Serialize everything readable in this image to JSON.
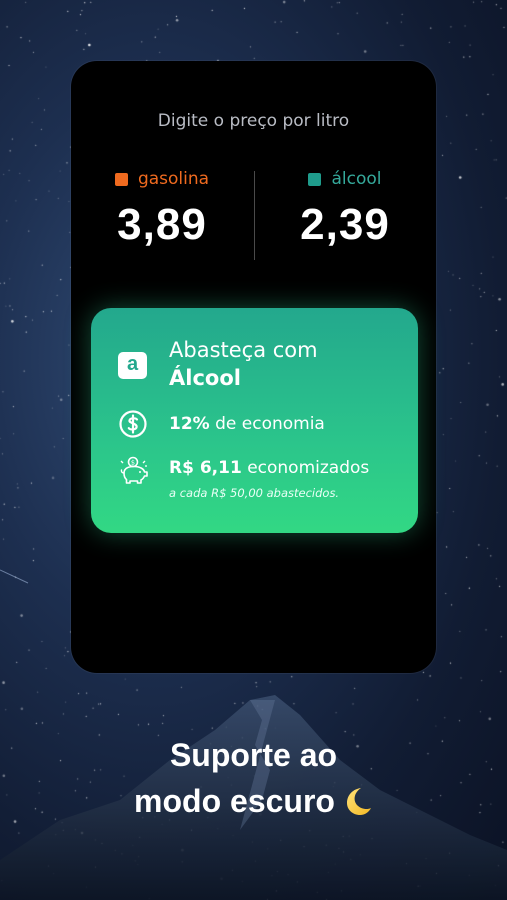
{
  "prompt": "Digite o preço por litro",
  "fuels": {
    "gasoline": {
      "label": "gasolina",
      "price": "3,89",
      "color": "#ef6a1f",
      "icon": "square-swatch-icon"
    },
    "alcohol": {
      "label": "álcool",
      "price": "2,39",
      "color": "#1f9c8c",
      "icon": "square-swatch-icon"
    }
  },
  "recommendation": {
    "badge": "a",
    "line1": "Abasteça com",
    "fuel": "Álcool",
    "economy_percent": "12%",
    "economy_text": "de economia",
    "savings_value": "R$ 6,11",
    "savings_text": "economizados",
    "savings_note": "a cada R$ 50,00 abastecidos.",
    "icons": [
      "dollar-coin-icon",
      "piggy-bank-icon"
    ]
  },
  "caption": {
    "line1": "Suporte ao",
    "line2": "modo escuro",
    "icon": "crescent-moon-icon"
  },
  "colors": {
    "card_background": "#000000",
    "result_gradient_top": "#23a88d",
    "result_gradient_bottom": "#32d884"
  }
}
